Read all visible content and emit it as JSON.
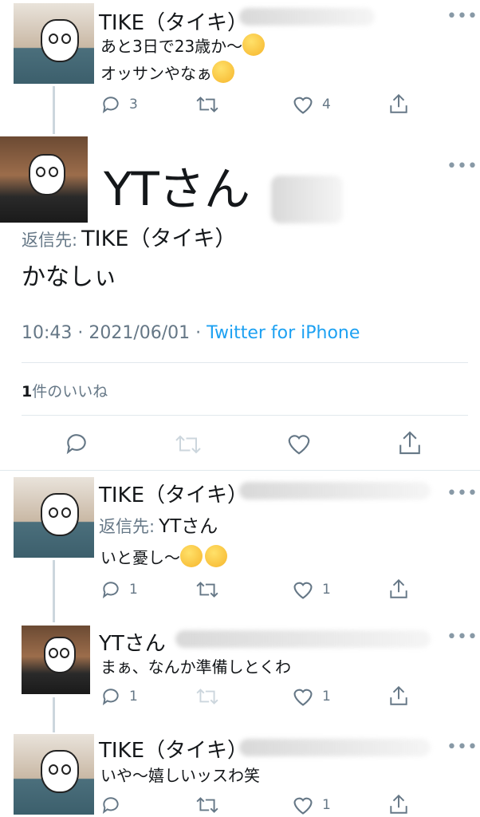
{
  "tweet1": {
    "name": "TIKE（タイキ）",
    "line1": "あと3日で23歳か〜",
    "line2": "オッサンやなぁ",
    "reply_count": "3",
    "like_count": "4"
  },
  "main": {
    "name": "YTさん",
    "reply_label": "返信先:",
    "reply_to": "TIKE（タイキ）",
    "text": "かなしぃ",
    "time": "10:43 · 2021/06/01 · ",
    "client": "Twitter for iPhone",
    "likes_num": "1",
    "likes_label": "件のいいね"
  },
  "tweet3": {
    "name": "TIKE（タイキ）",
    "reply_label": "返信先:",
    "reply_to": "YTさん",
    "text": "いと憂し〜",
    "reply_count": "1",
    "like_count": "1"
  },
  "tweet4": {
    "name": "YTさん",
    "text": "まぁ、なんか準備しとくわ",
    "reply_count": "1",
    "like_count": "1"
  },
  "tweet5": {
    "name": "TIKE（タイキ）",
    "text": "いや〜嬉しいッスわ笑",
    "like_count": "1"
  },
  "more_glyph": "•••",
  "colors": {
    "icon_gray": "#657786",
    "link_blue": "#1da1f2",
    "divider": "#e1e8ed"
  }
}
